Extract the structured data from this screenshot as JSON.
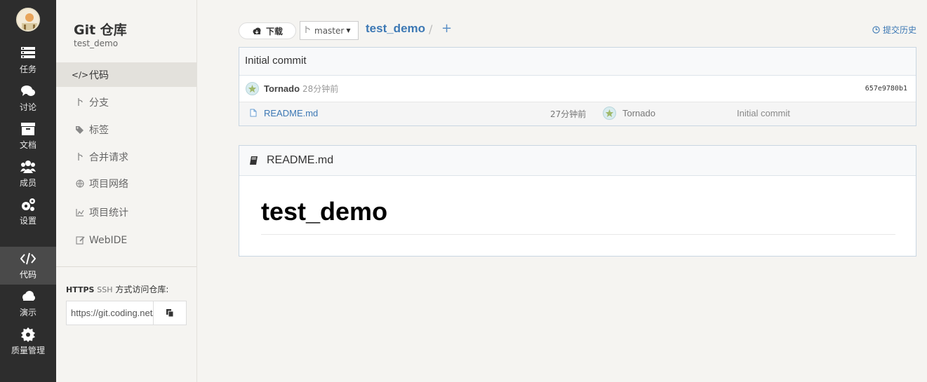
{
  "rail": {
    "items": [
      {
        "label": "任务",
        "icon": "tasks-icon"
      },
      {
        "label": "讨论",
        "icon": "chat-icon"
      },
      {
        "label": "文档",
        "icon": "archive-icon"
      },
      {
        "label": "成员",
        "icon": "users-icon"
      },
      {
        "label": "设置",
        "icon": "gear-icon"
      },
      {
        "label": "代码",
        "icon": "code-icon",
        "active": true
      },
      {
        "label": "演示",
        "icon": "cloud-icon"
      },
      {
        "label": "质量管理",
        "icon": "badge-icon"
      }
    ]
  },
  "sidebar": {
    "title": "Git 仓库",
    "subtitle": "test_demo",
    "menu": [
      {
        "label": "代码",
        "icon": "</>",
        "active": true
      },
      {
        "label": "分支",
        "icon": "branch-icon"
      },
      {
        "label": "标签",
        "icon": "tags-icon"
      },
      {
        "label": "合并请求",
        "icon": "merge-icon"
      },
      {
        "label": "项目网络",
        "icon": "globe-icon"
      },
      {
        "label": "项目统计",
        "icon": "chart-icon"
      },
      {
        "label": "WebIDE",
        "icon": "edit-icon"
      }
    ],
    "access": {
      "https": "HTTPS",
      "ssh": "SSH",
      "text": "方式访问仓库:",
      "url": "https://git.coding.net/"
    }
  },
  "toolbar": {
    "download_label": "下载",
    "branch": "master",
    "repo": "test_demo",
    "separator": "/",
    "add": "+",
    "history_label": "提交历史"
  },
  "commit": {
    "message": "Initial commit",
    "author": "Tornado",
    "time": "28分钟前",
    "sha": "657e9780b1"
  },
  "files": [
    {
      "name": "README.md",
      "time": "27分钟前",
      "author": "Tornado",
      "message": "Initial commit"
    }
  ],
  "readme": {
    "filename": "README.md",
    "heading": "test_demo"
  },
  "colors": {
    "rail_bg": "#2d2d2d",
    "link": "#3c78b4",
    "page_bg": "#f5f4f1"
  }
}
